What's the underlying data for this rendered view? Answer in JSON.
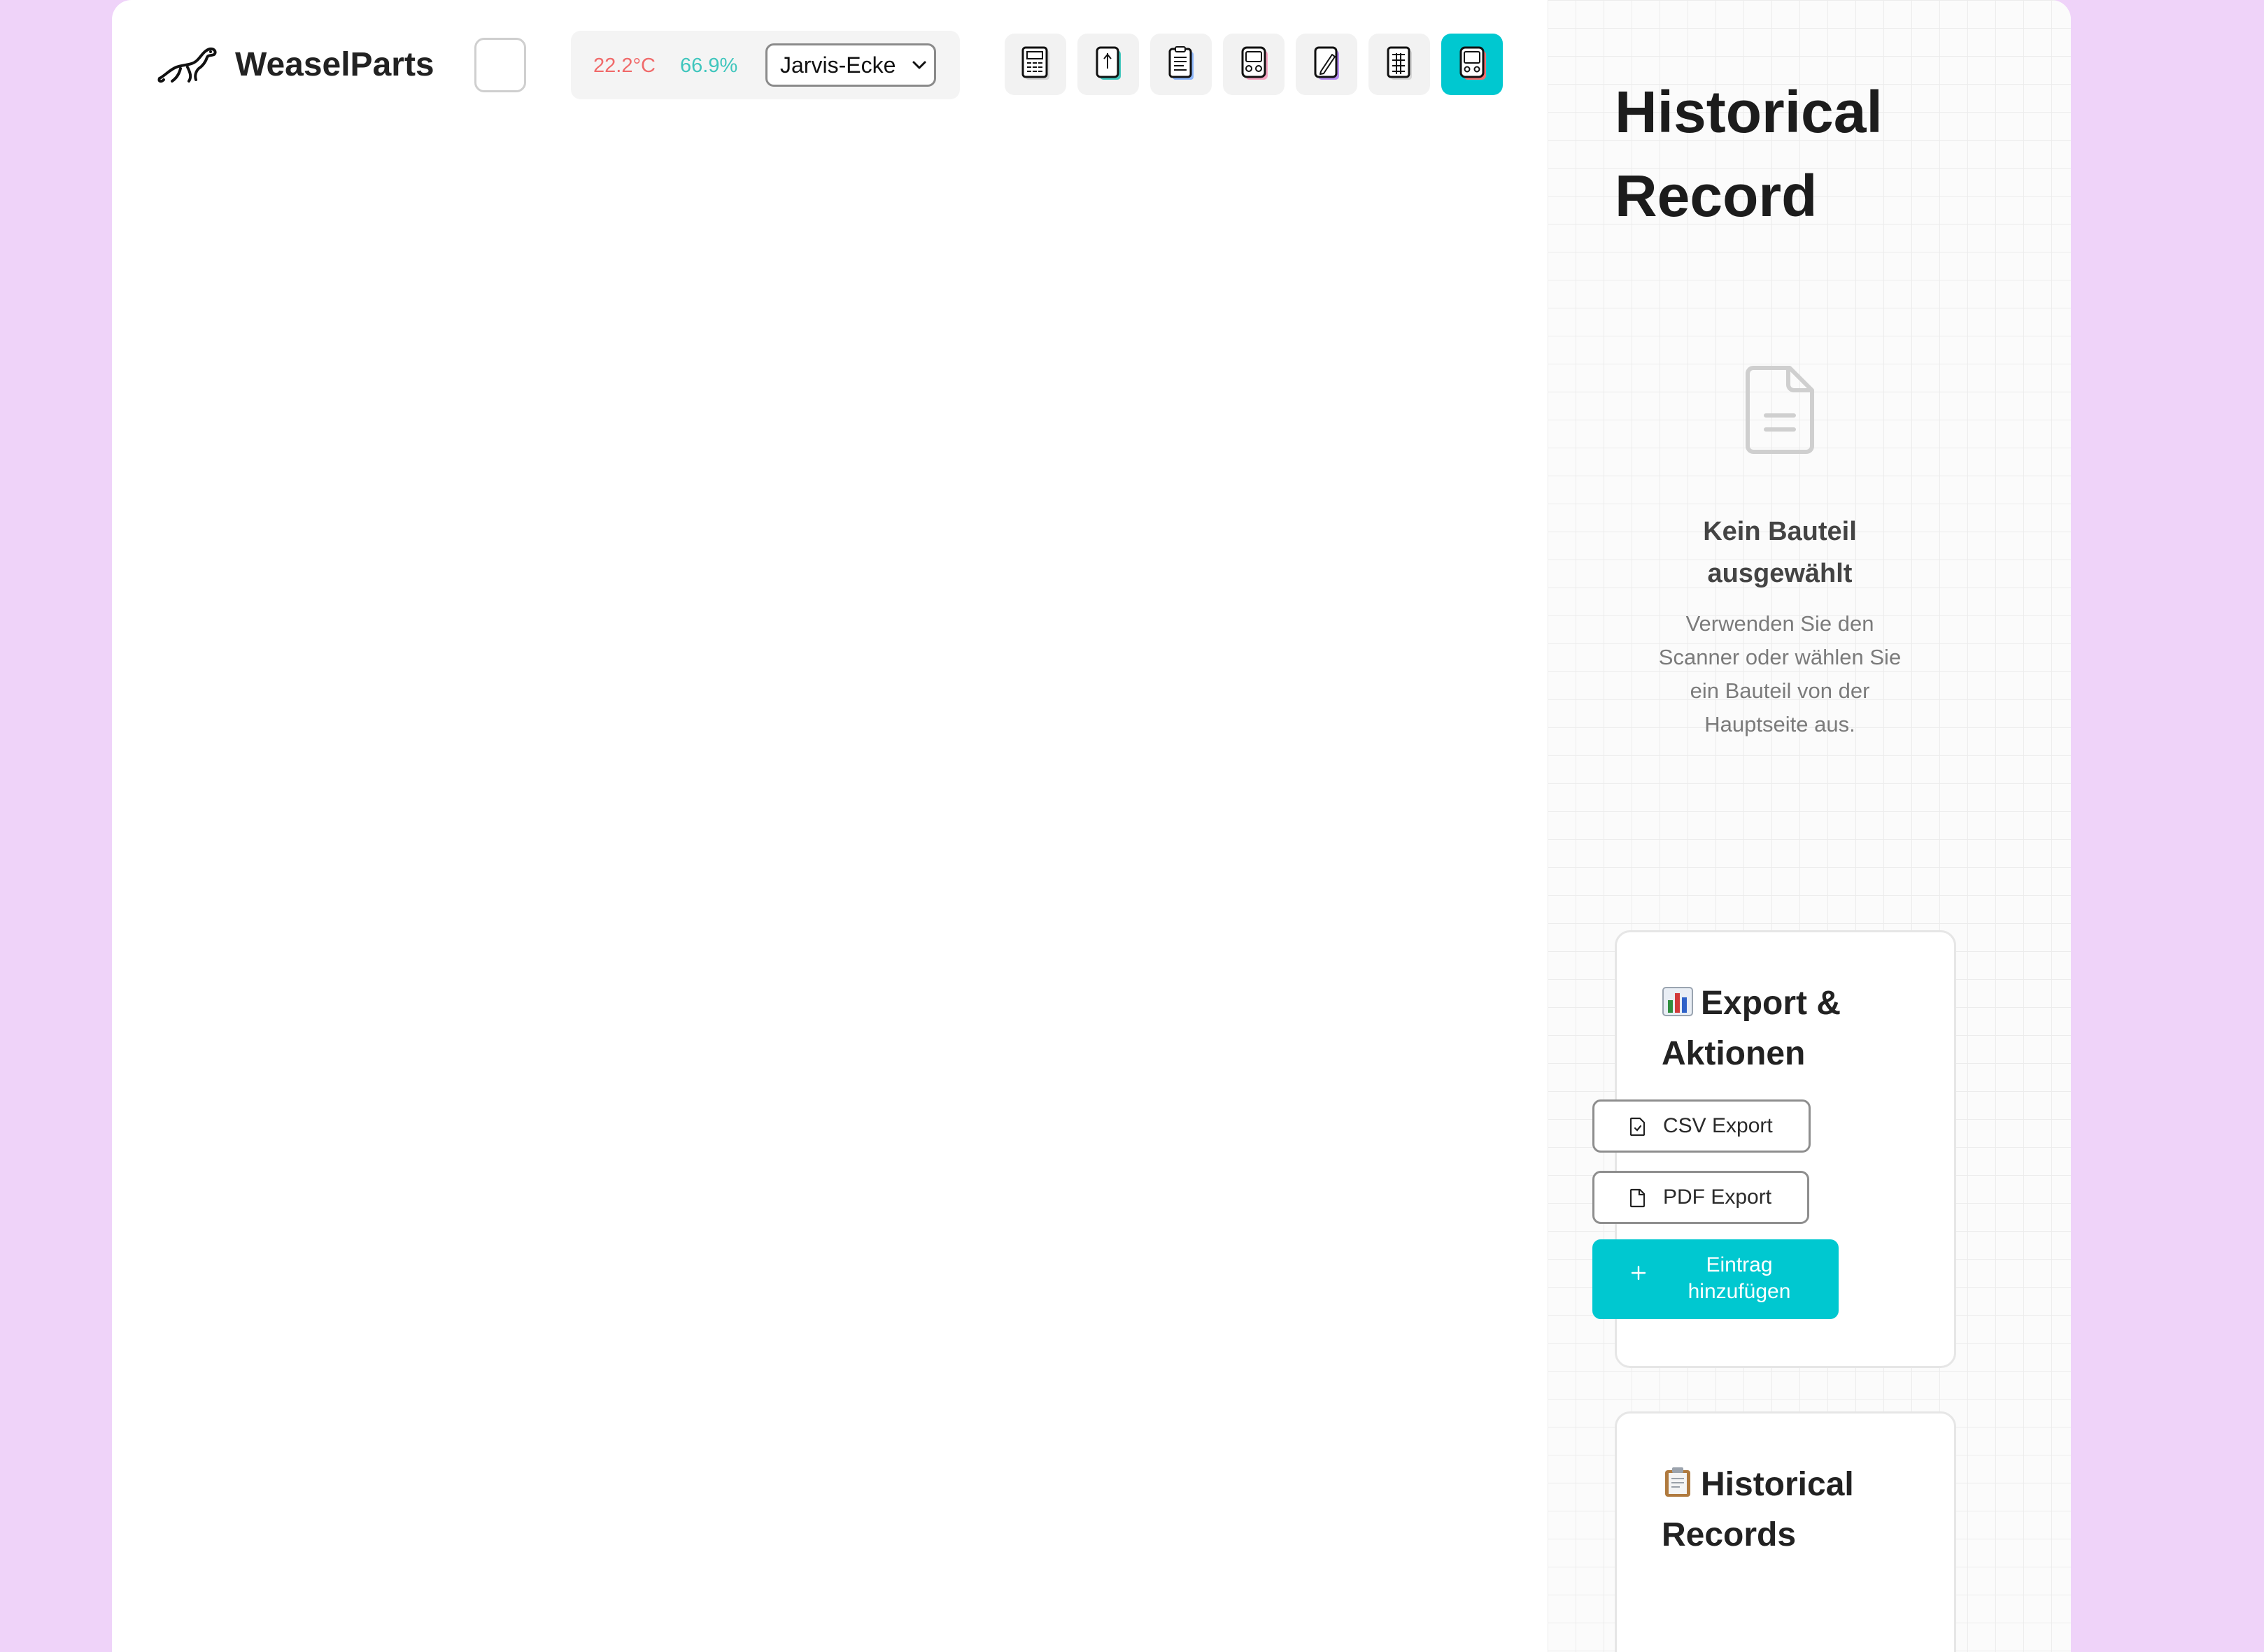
{
  "header": {
    "brand": "WeaselParts",
    "temperature": "22.2°C",
    "humidity": "66.9%",
    "location": "Jarvis-Ecke",
    "tools": [
      {
        "icon": "calculator-icon"
      },
      {
        "icon": "phone-icon"
      },
      {
        "icon": "clipboard-icon"
      },
      {
        "icon": "cassette-icon"
      },
      {
        "icon": "pencil-icon"
      },
      {
        "icon": "grid-calculator-icon"
      },
      {
        "icon": "radio-icon",
        "active": true
      }
    ],
    "colors": {
      "temp": "#f06a6a",
      "humidity": "#3fc6bd",
      "accent": "#00c8d0"
    }
  },
  "side": {
    "title": "Historical Record",
    "empty": {
      "icon": "document-icon",
      "title": "Kein Bauteil ausgewählt",
      "text": "Verwenden Sie den Scanner oder wählen Sie ein Bauteil von der Hauptseite aus."
    },
    "export_card": {
      "emoji": "bar-chart-icon",
      "title": "Export & Aktionen",
      "csv_label": "CSV Export",
      "pdf_label": "PDF Export",
      "add_label": "Eintrag hinzufügen"
    },
    "records_card": {
      "emoji": "clipboard-icon",
      "title": "Historical Records"
    }
  }
}
